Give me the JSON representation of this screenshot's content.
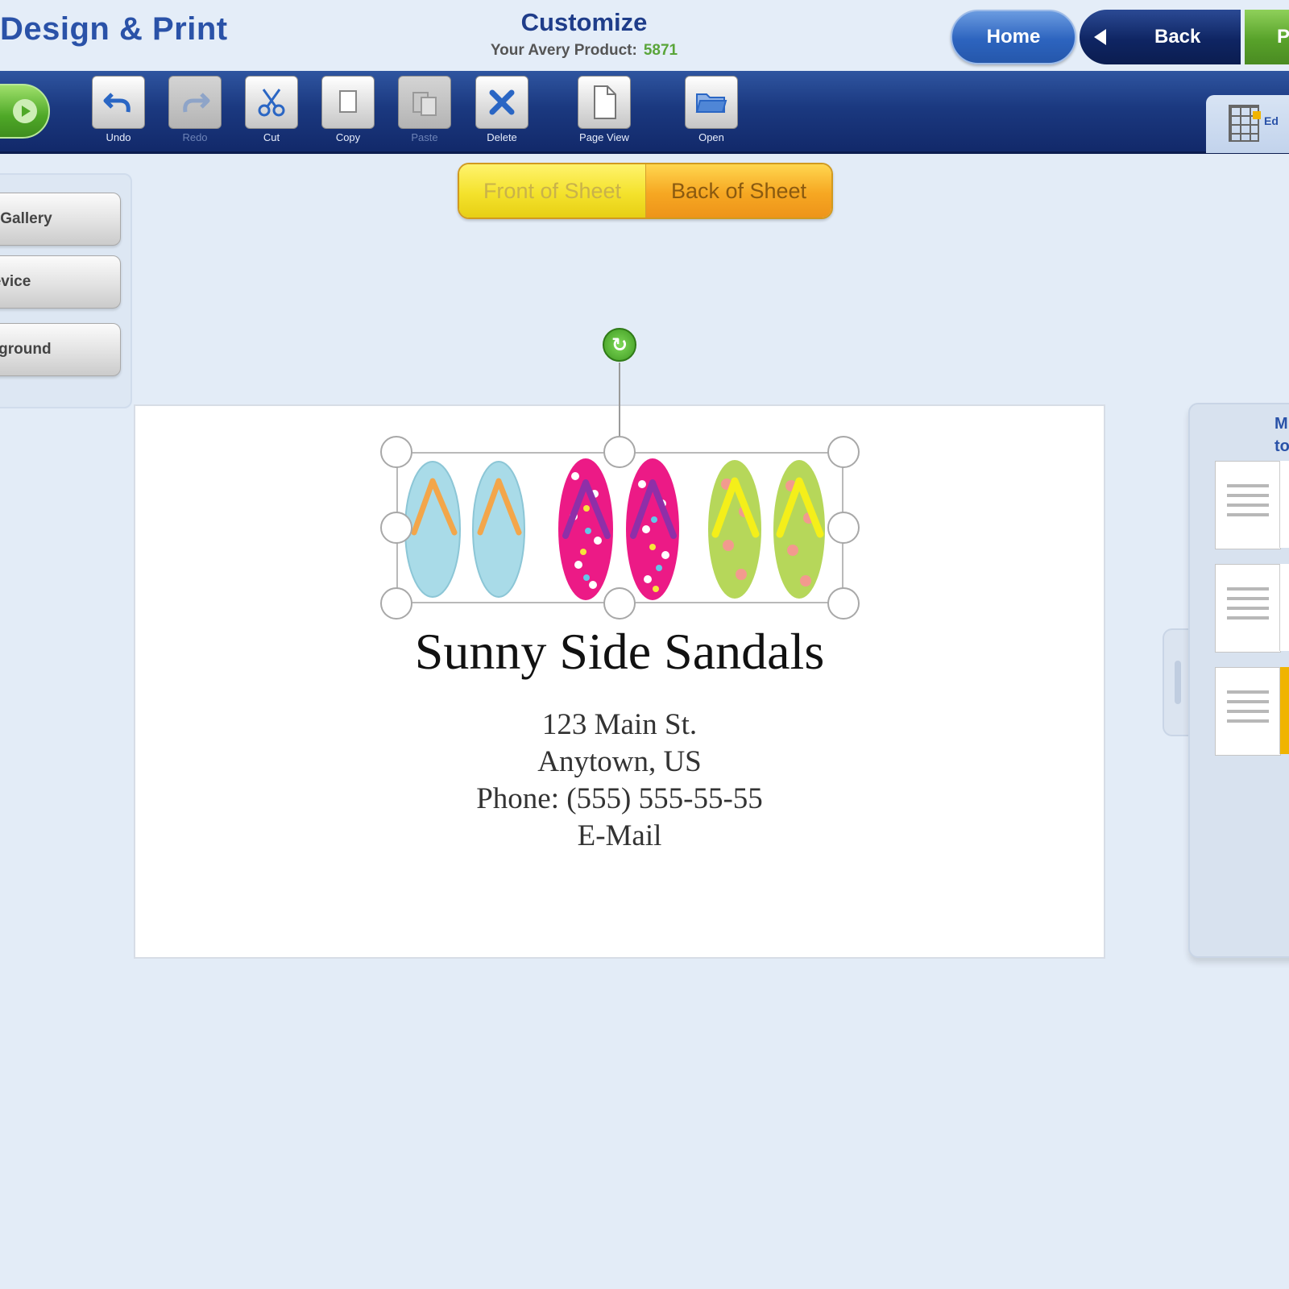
{
  "header": {
    "app_title": "Design & Print",
    "page_title": "Customize",
    "product_label": "Your Avery Product:",
    "product_number": "5871",
    "home_label": "Home",
    "back_label": "Back",
    "next_label": "P"
  },
  "toolbar": {
    "tools": [
      {
        "label": "Undo",
        "icon": "undo-icon",
        "enabled": true
      },
      {
        "label": "Redo",
        "icon": "redo-icon",
        "enabled": false
      },
      {
        "label": "Cut",
        "icon": "scissors-icon",
        "enabled": true
      },
      {
        "label": "Copy",
        "icon": "copy-icon",
        "enabled": true
      },
      {
        "label": "Paste",
        "icon": "paste-icon",
        "enabled": false
      },
      {
        "label": "Delete",
        "icon": "delete-icon",
        "enabled": true
      },
      {
        "label": "Page View",
        "icon": "page-icon",
        "enabled": true
      },
      {
        "label": "Open",
        "icon": "open-icon",
        "enabled": true
      }
    ],
    "edit_tab_label": "Ed"
  },
  "left_panel": {
    "items": [
      {
        "label": "ry Gallery"
      },
      {
        "label": "Device"
      },
      {
        "label": "ckground"
      }
    ]
  },
  "sheet_toggle": {
    "front_label": "Front of Sheet",
    "back_label": "Back of Sheet",
    "selected": "Back of Sheet"
  },
  "canvas": {
    "business_name": "Sunny Side Sandals",
    "address_lines": [
      "123 Main St.",
      "Anytown, US",
      "Phone: (555) 555-55-55",
      "E-Mail"
    ],
    "image": "flip-flops-clipart"
  },
  "right_panel": {
    "title_lines": [
      "M",
      "to"
    ]
  },
  "colors": {
    "brand_blue": "#2a52a8",
    "toolbar_blue": "#1b3980",
    "accent_green": "#5aa53a",
    "toggle_yellow": "#f4e22c",
    "toggle_orange": "#f6a722"
  }
}
